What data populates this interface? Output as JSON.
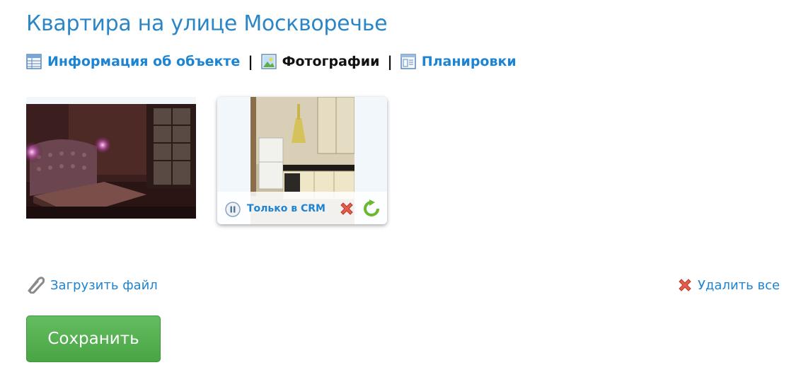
{
  "page": {
    "title": "Квартира на улице Москворечье"
  },
  "tabs": [
    {
      "label": "Информация об объекте",
      "icon": "table-icon",
      "active": false
    },
    {
      "label": "Фотографии",
      "icon": "image-icon",
      "active": true
    },
    {
      "label": "Планировки",
      "icon": "layout-icon",
      "active": false
    }
  ],
  "tab_separator": "|",
  "photos": [
    {
      "subject": "bedroom",
      "status_label": null
    },
    {
      "subject": "kitchen",
      "status_label": "Только в CRM",
      "status_icon": "pause-icon",
      "actions": [
        "delete-icon",
        "rotate-icon"
      ]
    }
  ],
  "actions": {
    "upload_label": "Загрузить файл",
    "upload_icon": "paperclip-icon",
    "delete_all_label": "Удалить все",
    "delete_all_icon": "delete-icon",
    "save_label": "Сохранить"
  },
  "colors": {
    "link": "#1d84d3",
    "title": "#2b86c8",
    "save_button": "#55b050",
    "delete": "#e35d4a",
    "rotate": "#6ab82f"
  }
}
